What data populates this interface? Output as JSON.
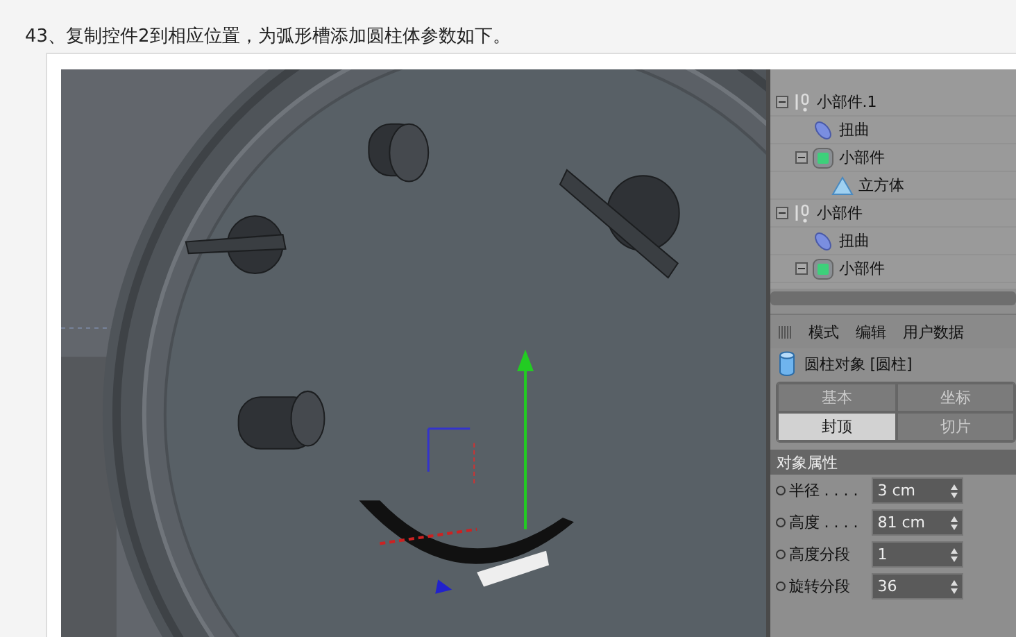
{
  "heading": "43、复制控件2到相应位置，为弧形槽添加圆柱体参数如下。",
  "object_tree": [
    {
      "label": "小部件.1",
      "kind": "null",
      "expanded": true,
      "children": [
        {
          "label": "扭曲",
          "kind": "deformer"
        },
        {
          "label": "小部件",
          "kind": "generator",
          "expanded": true,
          "children": [
            {
              "label": "立方体",
              "kind": "cone"
            }
          ]
        }
      ]
    },
    {
      "label": "小部件",
      "kind": "null",
      "expanded": true,
      "children": [
        {
          "label": "扭曲",
          "kind": "deformer"
        },
        {
          "label": "小部件",
          "kind": "generator",
          "expanded": true
        }
      ]
    }
  ],
  "attributes": {
    "menu": [
      "模式",
      "编辑",
      "用户数据"
    ],
    "object_title": "圆柱对象 [圆柱]",
    "tabs": [
      {
        "label": "基本",
        "selected": false
      },
      {
        "label": "坐标",
        "selected": false
      },
      {
        "label": "封顶",
        "selected": true
      },
      {
        "label": "切片",
        "selected": false
      }
    ],
    "section": "对象属性",
    "fields": [
      {
        "label": "半径 . . . .",
        "value": "3 cm"
      },
      {
        "label": "高度 . . . .",
        "value": "81 cm"
      },
      {
        "label": "高度分段",
        "value": "1"
      },
      {
        "label": "旋转分段",
        "value": "36"
      }
    ]
  }
}
